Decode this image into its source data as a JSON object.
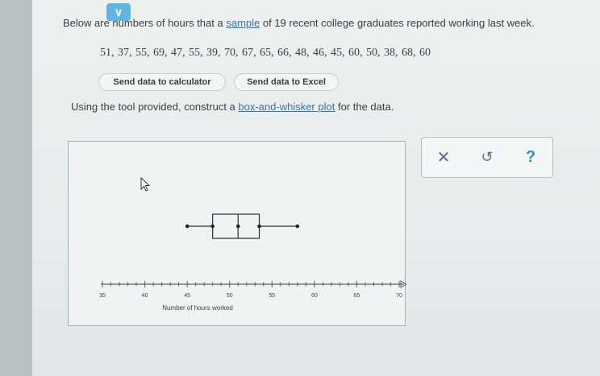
{
  "question": {
    "prefix": "Below are numbers of hours that a ",
    "link": "sample",
    "suffix": " of 19 recent college graduates reported working last week."
  },
  "data_values": "51, 37, 55, 69, 47, 55, 39, 70, 67, 65, 66, 48, 46, 45, 60, 50, 38, 68, 60",
  "buttons": {
    "calculator": "Send data to calculator",
    "excel": "Send data to Excel"
  },
  "instruction": {
    "prefix": "Using the tool provided, construct a ",
    "link": "box-and-whisker plot",
    "suffix": " for the data."
  },
  "tools": {
    "close": "✕",
    "undo": "↺",
    "help": "?"
  },
  "icons": {
    "collapse": "chevron-down-icon",
    "cursor": "pointer-cursor-icon"
  },
  "chart_data": {
    "type": "box",
    "xlabel": "Number of hours worked",
    "xlim": [
      35,
      70
    ],
    "ticks": [
      35,
      40,
      45,
      50,
      55,
      60,
      65,
      70
    ],
    "tick_labels": [
      "35",
      "40",
      "45",
      "50",
      "55",
      "60",
      "65",
      "70"
    ],
    "box": {
      "min": 45,
      "q1": 48,
      "median": 51,
      "q3": 53.5,
      "max": 58
    }
  }
}
